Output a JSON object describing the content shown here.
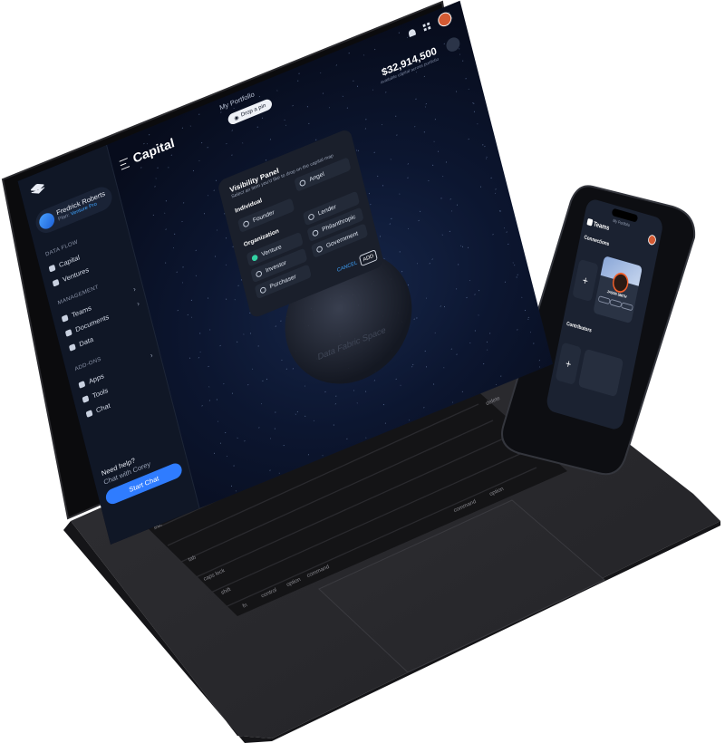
{
  "app": {
    "portfolio": "My Portfolio",
    "drop_pin": "Drop a pin",
    "page_title": "Capital",
    "amount": "$32,914,500",
    "amount_sub": "available capital across portfolio"
  },
  "user": {
    "name": "Fredrick Roberts",
    "plan_prefix": "Plan:",
    "plan": "Venture Pro"
  },
  "sidebar": {
    "section_data": "DATA FLOW",
    "items_a": [
      {
        "label": "Capital"
      },
      {
        "label": "Ventures"
      }
    ],
    "section_mgmt": "MANAGEMENT",
    "items_b": [
      {
        "label": "Teams"
      },
      {
        "label": "Documents"
      },
      {
        "label": "Data"
      }
    ],
    "section_addons": "ADD-ONS",
    "items_c": [
      {
        "label": "Apps"
      },
      {
        "label": "Tools"
      },
      {
        "label": "Chat"
      }
    ],
    "help_title": "Need help?",
    "help_sub": "Chat with Corey",
    "start_chat": "Start Chat"
  },
  "panel": {
    "title": "Visibility Panel",
    "subtitle": "Select an item you'd like to drop on the capital map",
    "group_individual": "Individual",
    "group_org": "Organization",
    "individual": [
      {
        "label": "Angel"
      },
      {
        "label": "Founder"
      }
    ],
    "organization": [
      {
        "label": "Lender"
      },
      {
        "label": "Venture"
      },
      {
        "label": "Philanthropic"
      },
      {
        "label": "Investor"
      },
      {
        "label": "Government"
      },
      {
        "label": "Purchaser"
      }
    ],
    "cancel": "CANCEL",
    "add": "ADD"
  },
  "phone": {
    "portfolio": "My Portfolio",
    "title": "Teams",
    "connections": "Connections",
    "contributors": "Contributors",
    "person_name": "JASON SMITH",
    "plus": "+"
  },
  "keyboard": {
    "esc": "esc",
    "delete": "delete",
    "tab": "tab",
    "caps": "caps lock",
    "shift": "shift",
    "fn": "fn",
    "control": "control",
    "option": "option",
    "command": "command"
  },
  "watermark": "Data Fabric Space"
}
